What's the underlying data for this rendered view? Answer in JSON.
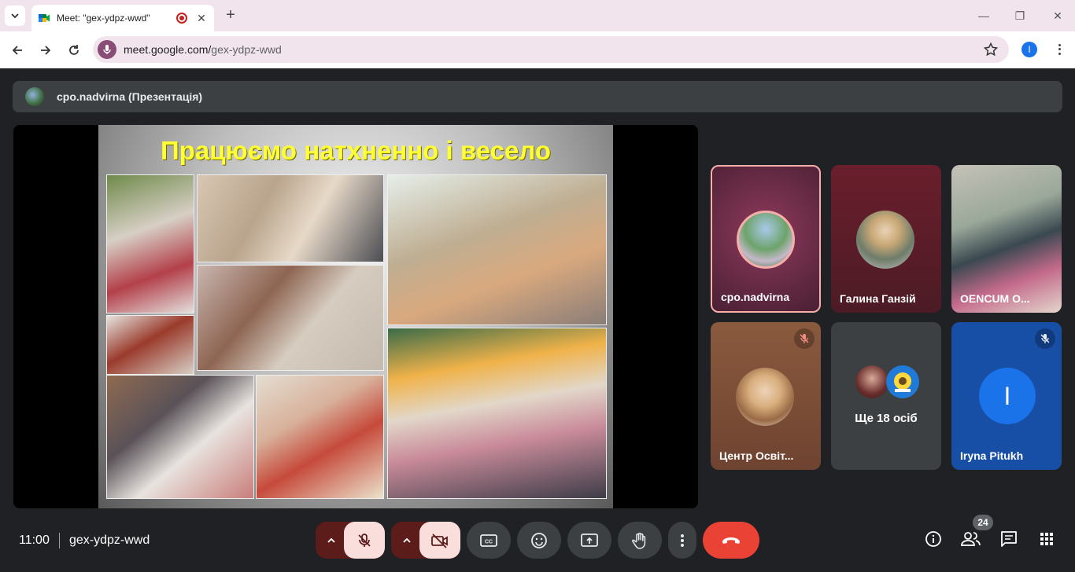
{
  "browser": {
    "tab_title": "Meet: \"gex-ydpz-wwd\"",
    "url_host": "meet.google.com/",
    "url_path": "gex-ydpz-wwd",
    "profile_initial": "I"
  },
  "meet": {
    "presenter_label": "cpo.nadvirna (Презентація)",
    "slide_title": "Працюємо натхненно і весело",
    "participants": [
      {
        "name": "cpo.nadvirna",
        "muted": false
      },
      {
        "name": "Галина Ганзій",
        "muted": false
      },
      {
        "name": "OENCUM O...",
        "muted": false
      },
      {
        "name": "Центр Освіт...",
        "muted": true
      },
      {
        "name": "Ще 18 осіб",
        "muted": false
      },
      {
        "name": "Iryna Pitukh",
        "muted": true,
        "initial": "I"
      }
    ],
    "time": "11:00",
    "meeting_code": "gex-ydpz-wwd",
    "people_count": "24"
  },
  "colors": {
    "end_call": "#ea4335",
    "slide_title": "#ffff33",
    "active_speaker_border": "#f6aea9"
  }
}
